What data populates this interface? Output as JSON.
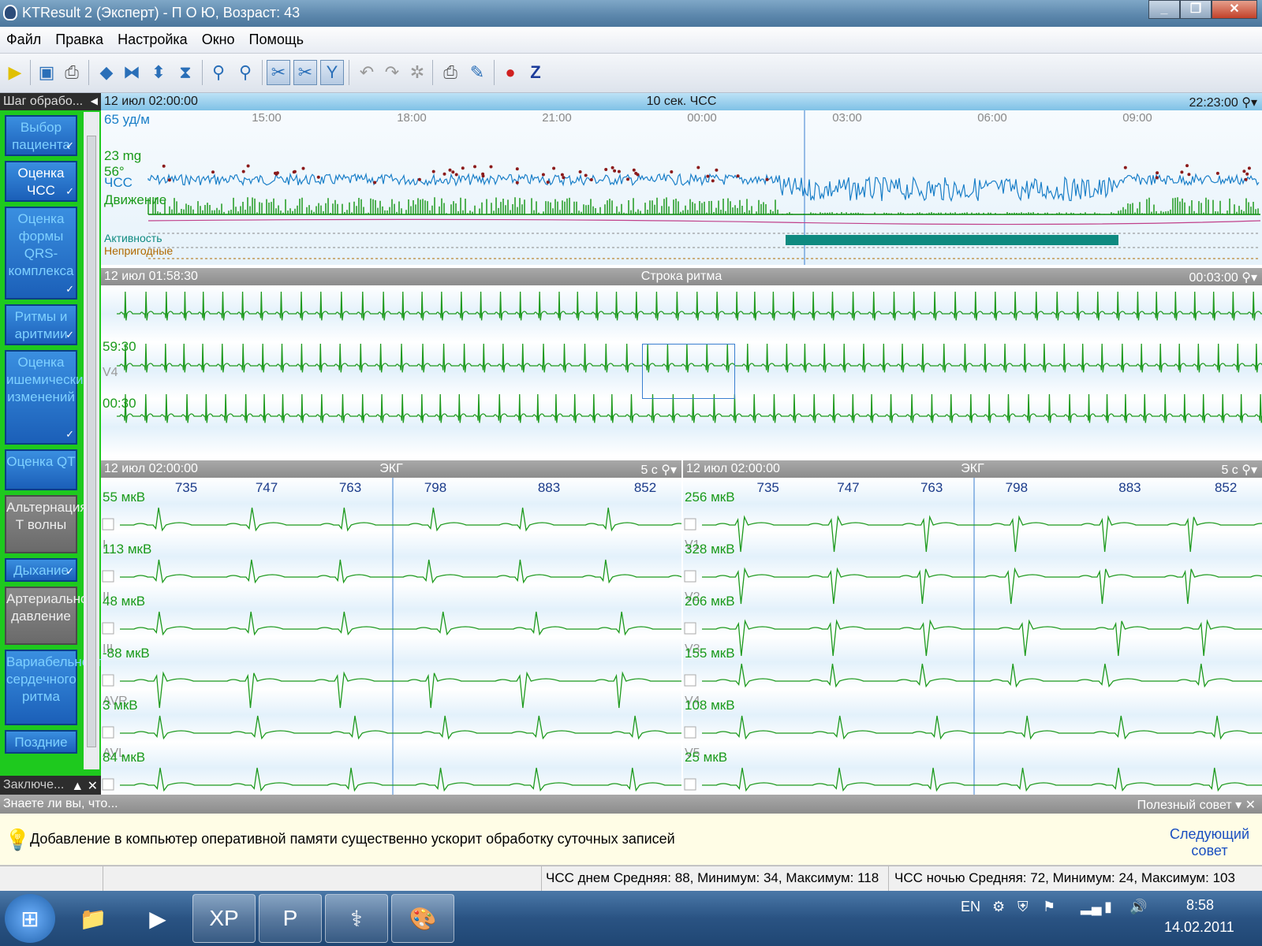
{
  "window": {
    "title": "KTResult 2 (Эксперт)  - П О Ю,  Возраст: 43"
  },
  "menu": [
    "Файл",
    "Правка",
    "Настройка",
    "Окно",
    "Помощь"
  ],
  "toolbar": {
    "z_label": "Z"
  },
  "left_panel": {
    "header": "Шаг обрабо...",
    "steps": [
      {
        "label": "Выбор пациента",
        "done": true
      },
      {
        "label": "Оценка ЧСС",
        "done": true,
        "active": true
      },
      {
        "label": "Оценка формы QRS-комплекса",
        "done": true
      },
      {
        "label": "Ритмы и аритмии",
        "done": true
      },
      {
        "label": "Оценка ишемических изменений",
        "done": true
      },
      {
        "label": "Оценка QT",
        "done": false
      },
      {
        "label": "Альтернация Т волны",
        "done": false,
        "disabled": true
      },
      {
        "label": "Дыхание",
        "done": true
      },
      {
        "label": "Артериальное давление",
        "done": false,
        "disabled": true
      },
      {
        "label": "Вариабельность сердечного ритма",
        "done": false
      },
      {
        "label": "Поздние",
        "done": false
      }
    ],
    "bottom": "Заключе..."
  },
  "trend": {
    "start": "12 июл 02:00:00",
    "title": "10 сек. ЧСС",
    "end": "22:23:00",
    "hr_label": "65 уд/м",
    "mg_label": "23 mg",
    "deg_label": "56°",
    "chss_label": "ЧСС",
    "move_label": "Движение",
    "act_label": "Активность",
    "bad_label": "Непригодные",
    "times": [
      "15:00",
      "18:00",
      "21:00",
      "00:00",
      "03:00",
      "06:00",
      "09:00"
    ]
  },
  "rhythm": {
    "start": "12 июл 01:58:30",
    "title": "Строка ритма",
    "end": "00:03:00",
    "row2_label": "59:30",
    "row2_lead": "V4",
    "row3_label": "00:30"
  },
  "ecg_left": {
    "start": "12 июл 02:00:00",
    "title": "ЭКГ",
    "scale": "5 с",
    "beats": [
      "735",
      "747",
      "763",
      "798",
      "883",
      "852"
    ],
    "leads": [
      {
        "amp": "55 мкВ",
        "name": "I"
      },
      {
        "amp": "113 мкВ",
        "name": "II"
      },
      {
        "amp": "48 мкВ",
        "name": "III"
      },
      {
        "amp": "-88 мкВ",
        "name": "AVR"
      },
      {
        "amp": "3 мкВ",
        "name": "AVL"
      },
      {
        "amp": "84 мкВ",
        "name": "AVF"
      }
    ]
  },
  "ecg_right": {
    "start": "12 июл 02:00:00",
    "title": "ЭКГ",
    "scale": "5 с",
    "beats": [
      "735",
      "747",
      "763",
      "798",
      "883",
      "852"
    ],
    "leads": [
      {
        "amp": "256 мкВ",
        "name": "V1"
      },
      {
        "amp": "328 мкВ",
        "name": "V2"
      },
      {
        "amp": "206 мкВ",
        "name": "V3"
      },
      {
        "amp": "155 мкВ",
        "name": "V4"
      },
      {
        "amp": "108 мкВ",
        "name": "V5"
      },
      {
        "amp": "25 мкВ",
        "name": "V6"
      }
    ]
  },
  "tip": {
    "bar_left": "Знаете ли вы, что...",
    "bar_right": "Полезный совет",
    "text": "Добавление в компьютер оперативной памяти существенно ускорит обработку суточных записей",
    "next1": "Следующий",
    "next2": "совет"
  },
  "status": {
    "day": "ЧСС днем Средняя: 88, Минимум: 34,  Максимум: 118",
    "night": "ЧСС ночью Средняя: 72, Минимум: 24,  Максимум: 103"
  },
  "taskbar": {
    "lang": "EN",
    "time": "8:58",
    "date": "14.02.2011"
  },
  "colors": {
    "ecg": "#1e9a1e",
    "hr": "#1a7fc8",
    "activity": "#0e8a80",
    "accent": "#1b5fb8"
  }
}
